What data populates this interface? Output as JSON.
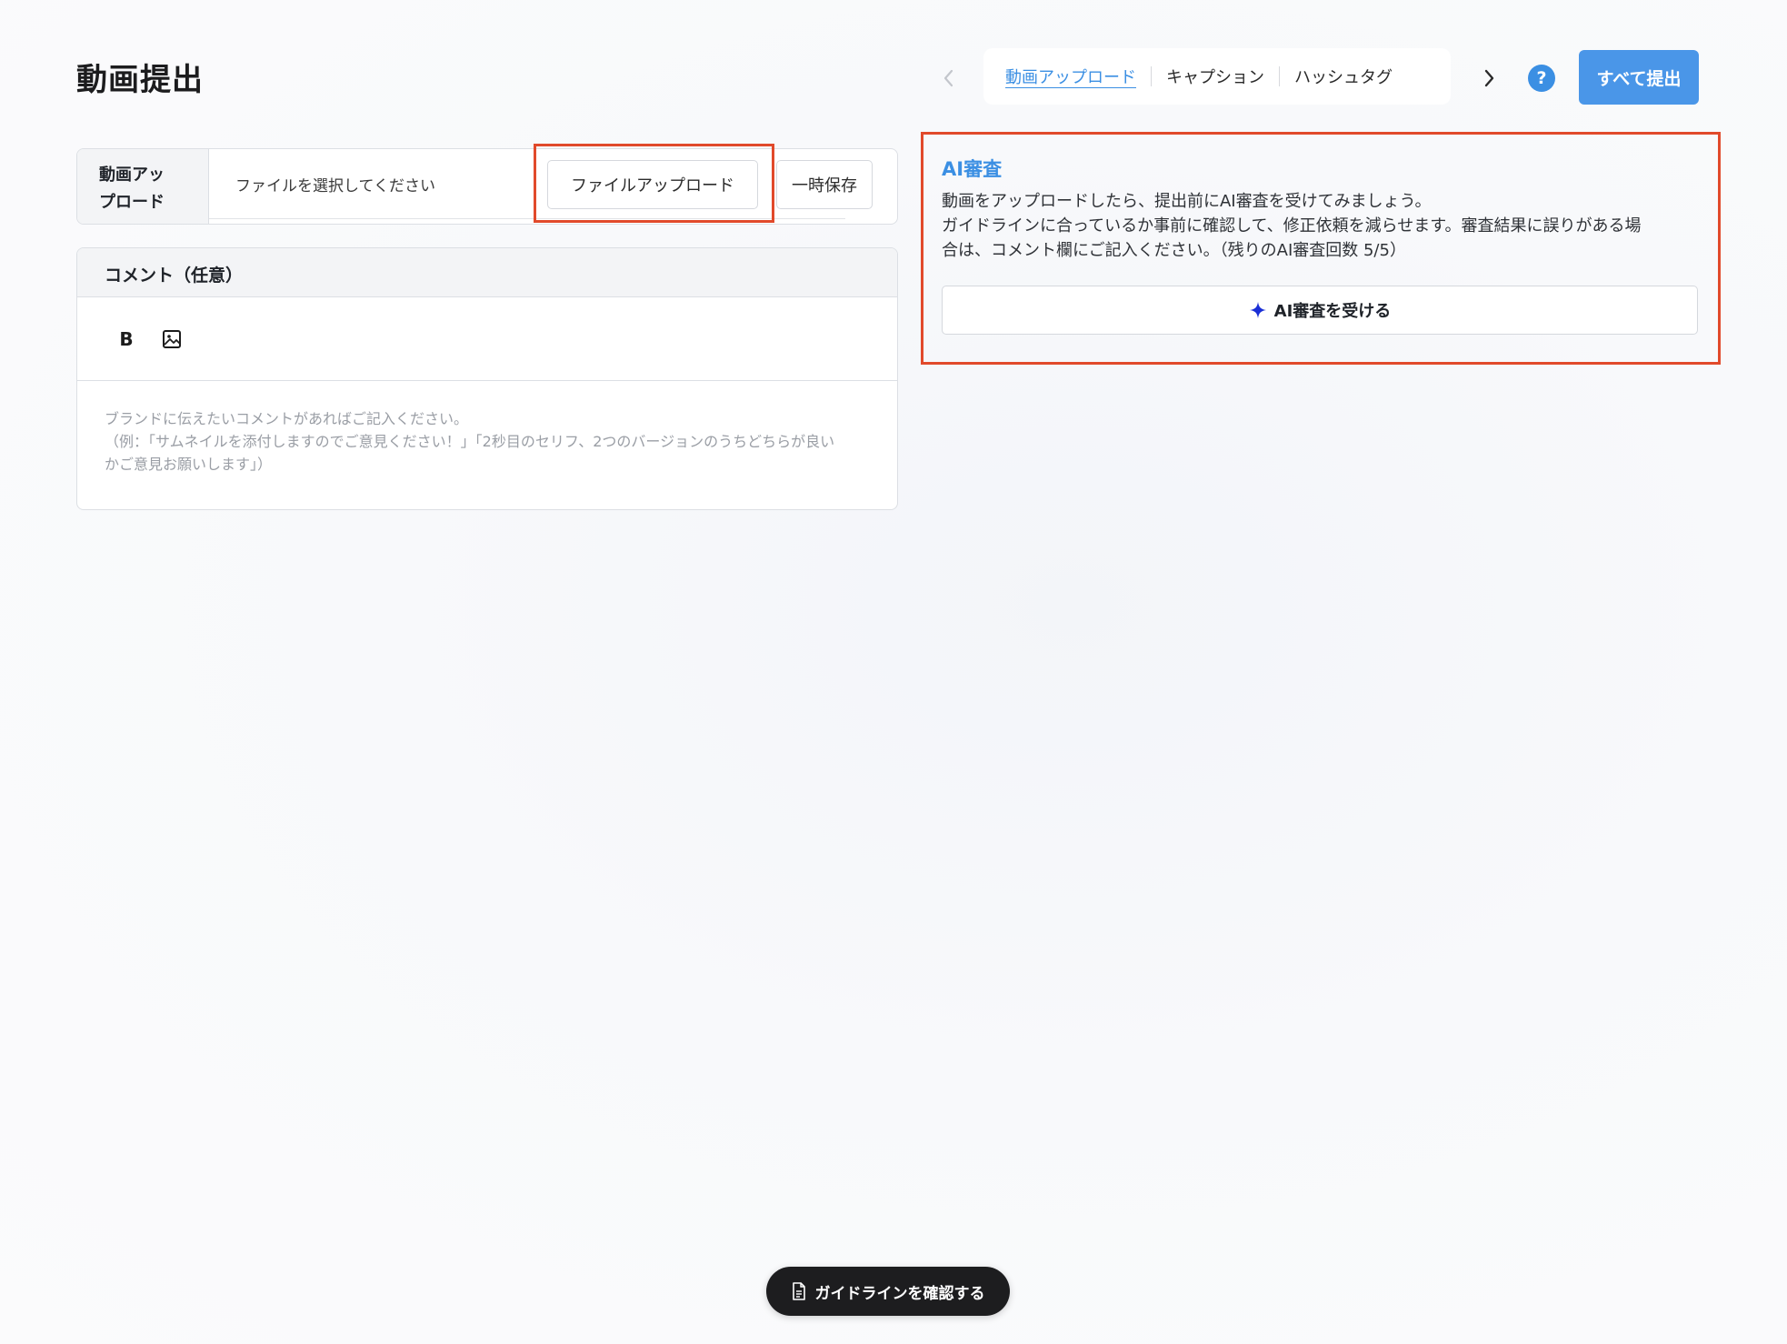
{
  "page": {
    "title": "動画提出"
  },
  "nav": {
    "tabs": [
      {
        "label": "動画アップロード",
        "active": true
      },
      {
        "label": "キャプション",
        "active": false
      },
      {
        "label": "ハッシュタグ",
        "active": false
      }
    ],
    "prev_icon": "chevron-left-icon",
    "next_icon": "chevron-right-icon",
    "help_label": "?",
    "submit_all_label": "すべて提出"
  },
  "upload": {
    "label": "動画アップ ロード",
    "label_line1": "動画アッ",
    "label_line2": "プロード",
    "placeholder": "ファイルを選択してください",
    "upload_button_label": "ファイルアップロード",
    "temp_save_label": "一時保存"
  },
  "comment": {
    "header": "コメント（任意）",
    "bold_label": "B",
    "image_icon": "image-icon",
    "placeholder_lines": [
      "ブランドに伝えたいコメントがあればご記入ください。",
      "（例：「サムネイルを添付しますのでご意見ください！」「2秒目のセリフ、2つのバージョンのうちどちらが良い",
      "かご意見お願いします」）"
    ]
  },
  "ai_review": {
    "title": "AI審査",
    "description_lines": [
      "動画をアップロードしたら、提出前にAI審査を受けてみましょう。",
      "ガイドラインに合っているか事前に確認して、修正依頼を減らせます。審査結果に誤りがある場",
      "合は、コメント欄にご記入ください。（残りのAI審査回数 5/5）"
    ],
    "button_label": "AI審査を受ける",
    "button_icon": "sparkle-icon"
  },
  "guideline": {
    "label": "ガイドラインを確認する",
    "icon": "document-icon"
  },
  "colors": {
    "accent": "#3b8fe3",
    "submit_button": "#4a96e8",
    "highlight_border": "#e14a2b",
    "pill_background": "#1d1d1f",
    "sparkle": "#1a2fd6"
  }
}
